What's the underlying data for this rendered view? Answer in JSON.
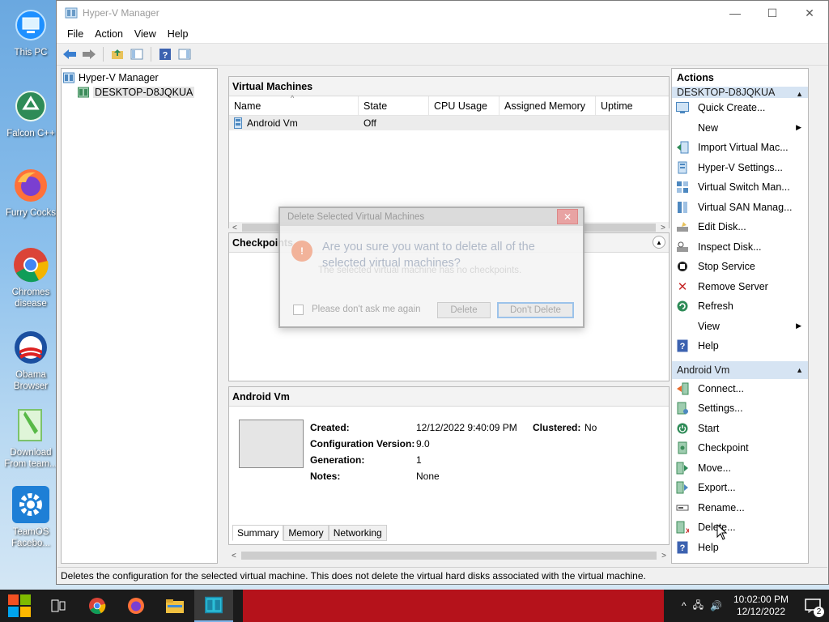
{
  "desktop": {
    "icons": [
      {
        "label": "This PC",
        "icon": "monitor-icon"
      },
      {
        "label": "Falcon C++",
        "icon": "recycle-icon"
      },
      {
        "label": "Furry Cocks",
        "icon": "firefox-icon"
      },
      {
        "label": "Chromes disease",
        "icon": "chrome-icon"
      },
      {
        "label": "Obama Browser",
        "icon": "obama-icon"
      },
      {
        "label": "Download From team...",
        "icon": "notebook-icon"
      },
      {
        "label": "TeamOS Facebo...",
        "icon": "gear-icon"
      }
    ]
  },
  "window": {
    "title": "Hyper-V Manager",
    "menu": [
      "File",
      "Action",
      "View",
      "Help"
    ],
    "controls": {
      "minimize": "—",
      "maximize": "☐",
      "close": "✕"
    }
  },
  "tree": {
    "root": "Hyper-V Manager",
    "child": "DESKTOP-D8JQKUA"
  },
  "vms": {
    "header": "Virtual Machines",
    "columns": [
      "Name",
      "State",
      "CPU Usage",
      "Assigned Memory",
      "Uptime"
    ],
    "rows": [
      {
        "name": "Android Vm",
        "state": "Off",
        "cpu": "",
        "memory": "",
        "uptime": ""
      }
    ]
  },
  "checkpoints": {
    "header": "Checkpoints",
    "message": "The selected virtual machine has no checkpoints."
  },
  "details": {
    "header": "Android Vm",
    "created_label": "Created:",
    "created_value": "12/12/2022 9:40:09 PM",
    "clustered_label": "Clustered:",
    "clustered_value": "No",
    "config_label": "Configuration Version:",
    "config_value": "9.0",
    "generation_label": "Generation:",
    "generation_value": "1",
    "notes_label": "Notes:",
    "notes_value": "None",
    "tabs": [
      "Summary",
      "Memory",
      "Networking"
    ]
  },
  "actions": {
    "header": "Actions",
    "host_group": "DESKTOP-D8JQKUA",
    "host_items": [
      {
        "label": "Quick Create...",
        "icon": "quick-create-icon"
      },
      {
        "label": "New",
        "icon": "",
        "submenu": true
      },
      {
        "label": "Import Virtual Mac...",
        "icon": "import-icon"
      },
      {
        "label": "Hyper-V Settings...",
        "icon": "settings-icon"
      },
      {
        "label": "Virtual Switch Man...",
        "icon": "switch-icon"
      },
      {
        "label": "Virtual SAN Manag...",
        "icon": "san-icon"
      },
      {
        "label": "Edit Disk...",
        "icon": "edit-disk-icon"
      },
      {
        "label": "Inspect Disk...",
        "icon": "inspect-disk-icon"
      },
      {
        "label": "Stop Service",
        "icon": "stop-icon"
      },
      {
        "label": "Remove Server",
        "icon": "remove-icon"
      },
      {
        "label": "Refresh",
        "icon": "refresh-icon"
      },
      {
        "label": "View",
        "icon": "",
        "submenu": true
      },
      {
        "label": "Help",
        "icon": "help-icon"
      }
    ],
    "vm_group": "Android Vm",
    "vm_items": [
      {
        "label": "Connect...",
        "icon": "connect-icon"
      },
      {
        "label": "Settings...",
        "icon": "vm-settings-icon"
      },
      {
        "label": "Start",
        "icon": "start-icon"
      },
      {
        "label": "Checkpoint",
        "icon": "checkpoint-icon"
      },
      {
        "label": "Move...",
        "icon": "move-icon"
      },
      {
        "label": "Export...",
        "icon": "export-icon"
      },
      {
        "label": "Rename...",
        "icon": "rename-icon"
      },
      {
        "label": "Delete...",
        "icon": "delete-icon"
      },
      {
        "label": "Help",
        "icon": "help-icon"
      }
    ]
  },
  "status": {
    "text": "Deletes the configuration for the selected virtual machine. This does not delete the virtual hard disks associated with the virtual machine."
  },
  "dialog": {
    "title": "Delete Selected Virtual Machines",
    "question": "Are you sure you want to delete all of the selected virtual machines?",
    "checkbox": "Please don't ask me again",
    "delete_button": "Delete",
    "dont_delete_button": "Don't Delete"
  },
  "taskbar": {
    "time": "10:02:00 PM",
    "date": "12/12/2022",
    "notifications": "2"
  }
}
